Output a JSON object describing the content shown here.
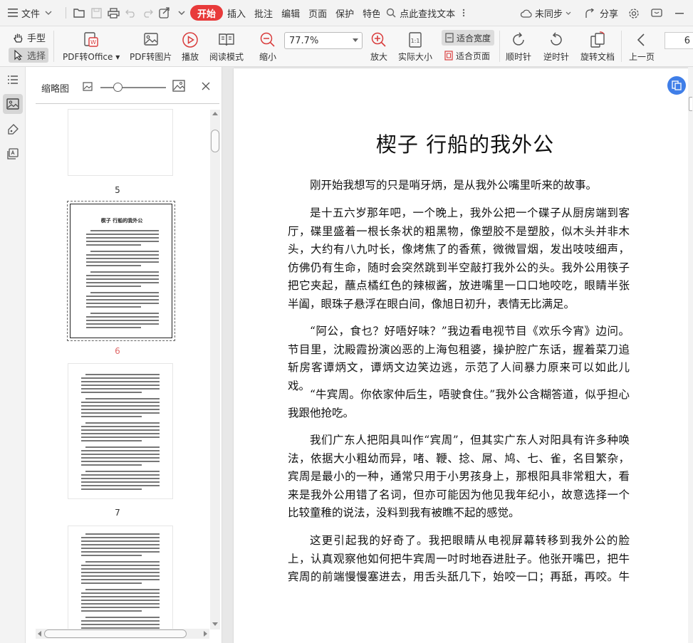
{
  "menubar": {
    "file": "文件",
    "tabs": [
      "开始",
      "插入",
      "批注",
      "编辑",
      "页面",
      "保护",
      "特色"
    ],
    "search": "点此查找文本",
    "sync": "未同步",
    "share": "分享"
  },
  "toolbar": {
    "hand": "手型",
    "select": "选择",
    "pdf_to_office": "PDF转Office",
    "pdf_to_image": "PDF转图片",
    "play": "播放",
    "read_mode": "阅读模式",
    "zoom_out": "缩小",
    "zoom_value": "77.7%",
    "zoom_in": "放大",
    "actual_size": "实际大小",
    "fit_width": "适合宽度",
    "fit_page": "适合页面",
    "rotate_cw": "顺时针",
    "rotate_ccw": "逆时针",
    "rotate_doc": "旋转文档",
    "prev_page": "上一页",
    "page_number": "6"
  },
  "thumbnails": {
    "title": "缩略图",
    "pages": [
      "5",
      "6",
      "7"
    ],
    "mini_title": "楔子 行船的我外公"
  },
  "document": {
    "title": "楔子 行船的我外公",
    "paragraphs": [
      "刚开始我想写的只是哨牙炳，是从我外公嘴里听来的故事。",
      "是十五六岁那年吧，一个晚上，我外公把一个碟子从厨房端到客厅，碟里盛着一根长条状的粗黑物，像塑胶不是塑胶，似木头并非木头，大约有八九吋长，像烤焦了的香蕉，微微冒烟，发出吱吱细声，仿佛仍有生命，随时会突然跳到半空敲打我外公的头。我外公用筷子把它夹起，蘸点橘红色的辣椒酱，放进嘴里一口口地咬吃，眼睛半张半阖，眼珠子悬浮在眼白间，像旭日初升，表情无比满足。",
      "“阿公，食乜？好唔好味？”我边看电视节目《欢乐今宵》边问。节目里，沈殿霞扮演凶恶的上海包租婆，操护腔广东话，握着菜刀追斩房客谭炳文，谭炳文边笑边逃，示范了人间暴力原来可以如此儿戏。",
      "“牛宾周。你依家仲后生，唔驶食住。”我外公含糊答道，似乎担心我跟他抢吃。",
      "我们广东人把阳具叫作“宾周”，但其实广东人对阳具有许多种唤法，依据大小粗幼而异，啫、鞭、捻、屌、鸠、七、雀，名目繁杂，宾周是最小的一种，通常只用于小男孩身上，那根阳具非常粗大，看来是我外公用错了名词，但亦可能因为他见我年纪小，故意选择一个比较童稚的说法，没料到我有被瞧不起的感觉。",
      "这更引起我的好奇了。我把眼睛从电视屏幕转移到我外公的脸上，认真观察他如何把牛宾周一吋时地吞进肚子。他张开嘴巴，把牛宾周的前端慢慢塞进去，用舌头舐几下，始咬一口；再舐，再咬。牛宾周在我"
    ]
  },
  "colors": {
    "accent": "#e83a3a",
    "float_button": "#3f7ee8",
    "selected_page_number": "#e06a6a"
  }
}
